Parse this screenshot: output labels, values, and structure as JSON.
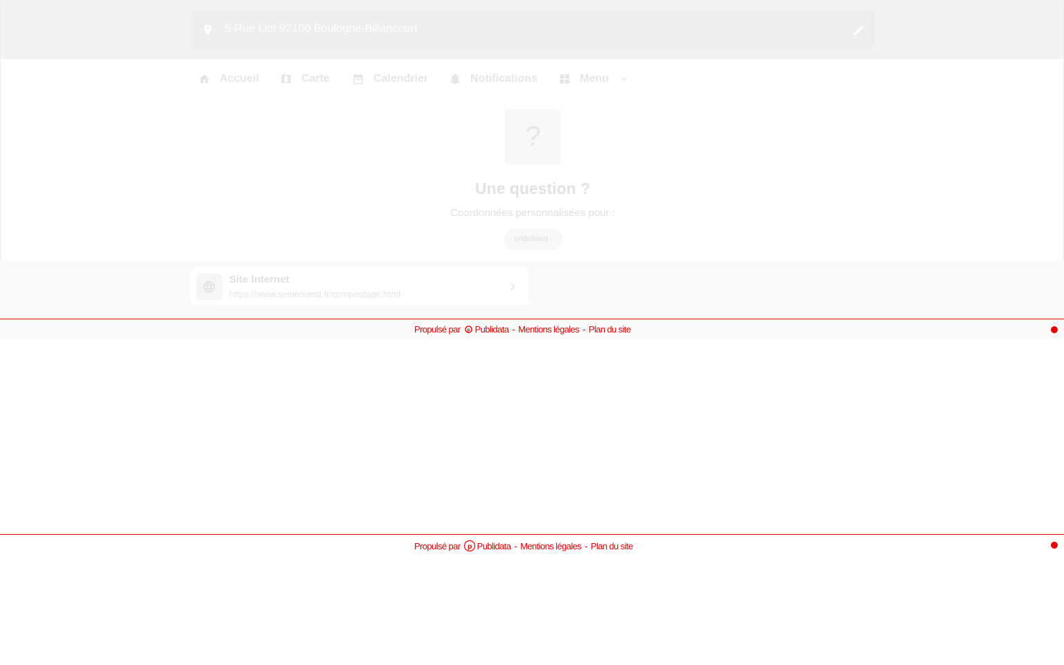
{
  "header": {
    "address": "5 Rue Liot 92100 Boulogne-Billancourt",
    "pin_icon": "location-pin-icon",
    "edit_icon": "pencil-icon"
  },
  "nav": {
    "items": [
      {
        "label": "Accueil",
        "icon": "home-icon"
      },
      {
        "label": "Carte",
        "icon": "map-icon"
      },
      {
        "label": "Calendrier",
        "icon": "calendar-icon"
      },
      {
        "label": "Notifications",
        "icon": "alarm-bell-icon"
      },
      {
        "label": "Menu",
        "icon": "grid-icon",
        "dropdown_icon": "chevron-down-icon"
      }
    ]
  },
  "question": {
    "symbol": "?",
    "title": "Une question ?",
    "subtitle": "Coordonnées personnalisées pour :",
    "pill": "undefined -"
  },
  "contact": {
    "title": "Site Internet",
    "url": "https://www.seineouest.fr/compostage.html",
    "icon": "globe-icon",
    "chevron_icon": "chevron-right-icon"
  },
  "footer": {
    "powered_by": "Propulsé par",
    "brand": "Publidata",
    "separator": "-",
    "legal": "Mentions légales",
    "sitemap": "Plan du site"
  },
  "colors": {
    "accent": "#ee0000",
    "faded_text": "#e6e6e6",
    "band_bg": "#f2f2f2"
  }
}
